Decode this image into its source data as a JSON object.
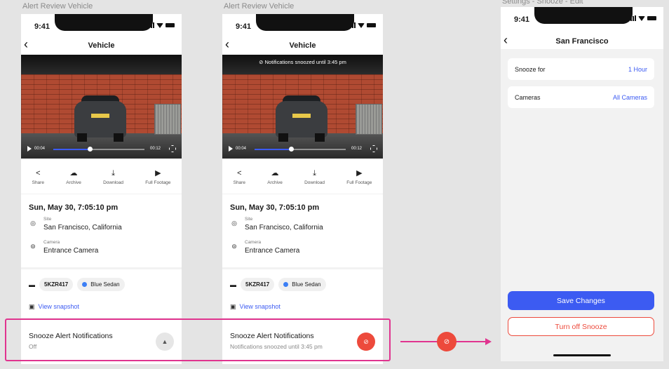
{
  "frames": {
    "frame1_label": "Alert Review Vehicle",
    "frame2_label": "Alert Review Vehicle",
    "frame3_label": "Settings - Snooze - Edit"
  },
  "status_bar": {
    "time": "9:41"
  },
  "vehicle_screen": {
    "title": "Vehicle",
    "video": {
      "current_time": "00:04",
      "duration": "00:12",
      "progress": 0.4
    },
    "actions": [
      {
        "label": "Share",
        "icon": "share-icon"
      },
      {
        "label": "Archive",
        "icon": "cloud-upload-icon"
      },
      {
        "label": "Download",
        "icon": "download-icon"
      },
      {
        "label": "Full Footage",
        "icon": "video-camera-icon"
      }
    ],
    "datetime": "Sun, May 30, 7:05:10 pm",
    "site_label": "Site",
    "site_value": "San Francisco, California",
    "camera_label": "Camera",
    "camera_value": "Entrance Camera",
    "plate": "5KZR417",
    "vehicle_desc": "Blue Sedan",
    "snapshot_link": "View snapshot",
    "snooze_title": "Snooze Alert Notifications"
  },
  "frame1": {
    "snooze_status": "Off"
  },
  "frame2": {
    "toast": "Notifications snoozed until 3:45 pm",
    "snooze_status": "Notifications snoozed until 3:45 pm"
  },
  "settings_screen": {
    "title": "San Francisco",
    "snooze_label": "Snooze for",
    "snooze_value": "1 Hour",
    "cameras_label": "Cameras",
    "cameras_value": "All Cameras",
    "save_label": "Save Changes",
    "turn_off_label": "Turn off Snooze"
  },
  "colors": {
    "accent_blue": "#3c5bf2",
    "alert_red": "#ed4a3c",
    "highlight_pink": "#e0348f"
  }
}
